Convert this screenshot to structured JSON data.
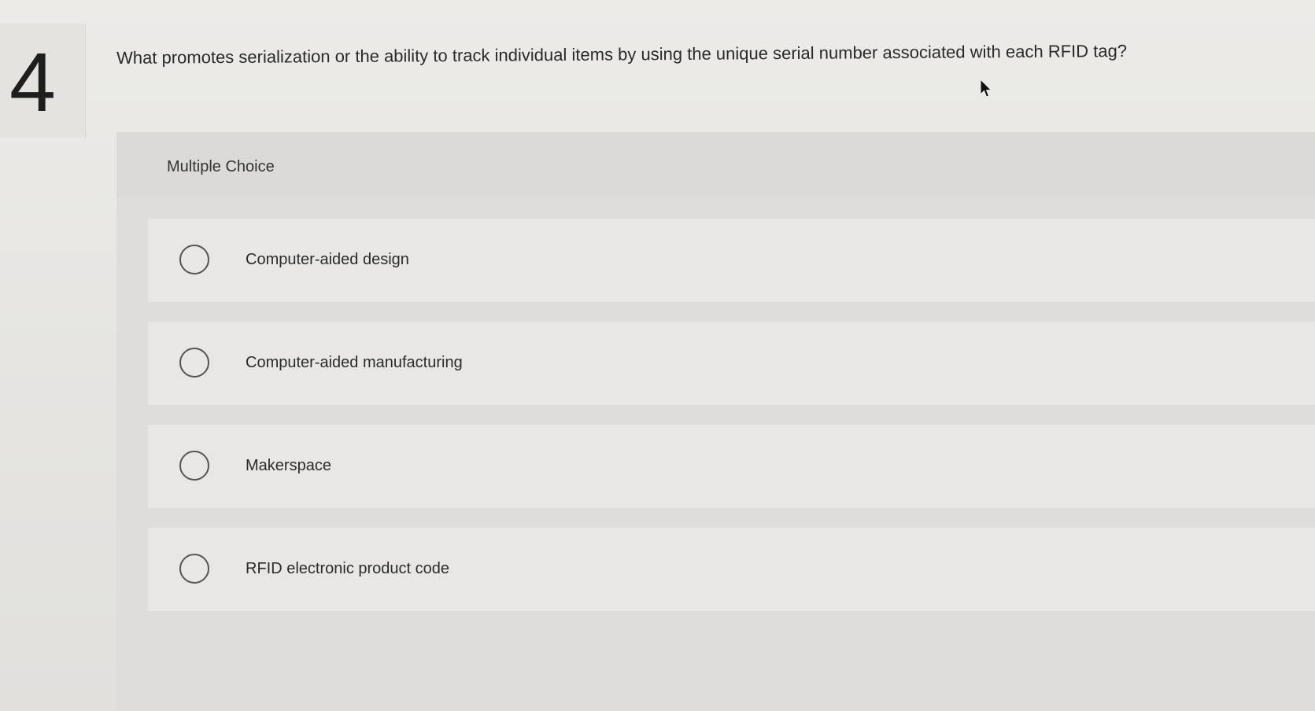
{
  "question": {
    "number": "4",
    "text": "What promotes serialization or the ability to track individual items by using the unique serial number associated with each RFID tag?"
  },
  "choices": {
    "type_label": "Multiple Choice",
    "options": [
      {
        "label": "Computer-aided design",
        "selected": false
      },
      {
        "label": "Computer-aided manufacturing",
        "selected": false
      },
      {
        "label": "Makerspace",
        "selected": false
      },
      {
        "label": "RFID electronic product code",
        "selected": false
      }
    ]
  },
  "icons": {
    "cursor": "mouse-pointer-icon",
    "radio": "radio-unselected-icon"
  },
  "colors": {
    "background": "#e6e6e4",
    "panel": "#dedddb",
    "option_row": "#e8e7e5",
    "text": "#2b2b2b"
  }
}
